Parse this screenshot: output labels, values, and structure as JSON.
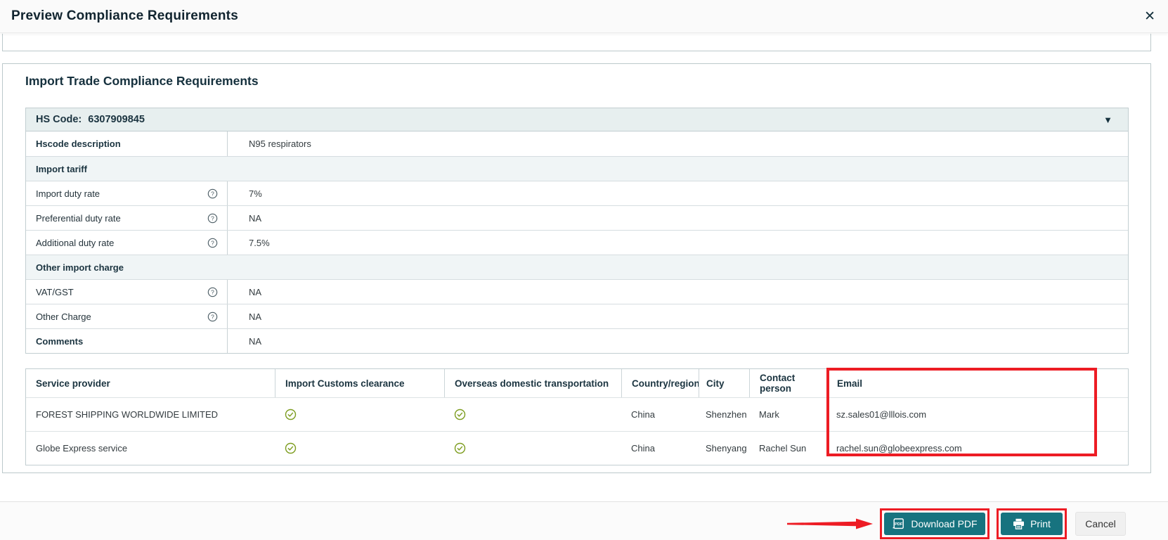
{
  "modal": {
    "title": "Preview Compliance Requirements"
  },
  "icons": {
    "close": "✕",
    "collapse_caret": "▼",
    "help": "?"
  },
  "section": {
    "heading": "Import Trade Compliance Requirements",
    "hs_code_label": "HS Code:",
    "hs_code_value": "6307909845"
  },
  "detail_table": {
    "rows": [
      {
        "type": "field",
        "label": "Hscode description",
        "value": "N95 respirators"
      },
      {
        "type": "section",
        "label": "Import tariff"
      },
      {
        "type": "field",
        "label": "Import duty rate",
        "value": "7%"
      },
      {
        "type": "field",
        "label": "Preferential duty rate",
        "value": "NA"
      },
      {
        "type": "field",
        "label": "Additional duty rate",
        "value": "7.5%"
      },
      {
        "type": "section",
        "label": "Other import charge"
      },
      {
        "type": "field",
        "label": "VAT/GST",
        "value": "NA"
      },
      {
        "type": "field",
        "label": "Other Charge",
        "value": "NA"
      },
      {
        "type": "field",
        "label": "Comments",
        "value": "NA"
      }
    ]
  },
  "providers_table": {
    "columns": [
      "Service provider",
      "Import Customs clearance",
      "Overseas domestic transportation",
      "Country/region",
      "City",
      "Contact person",
      "Email"
    ],
    "rows": [
      {
        "service_provider": "FOREST SHIPPING WORLDWIDE LIMITED",
        "import_customs_clearance": "yes",
        "overseas_domestic_transportation": "yes",
        "country": "China",
        "city": "Shenzhen",
        "contact": "Mark",
        "email": "sz.sales01@lllois.com"
      },
      {
        "service_provider": "Globe Express service",
        "import_customs_clearance": "yes",
        "overseas_domestic_transportation": "yes",
        "country": "China",
        "city": "Shenyang",
        "contact": "Rachel Sun",
        "email": "rachel.sun@globeexpress.com"
      }
    ]
  },
  "footer": {
    "download_pdf_label": "Download PDF",
    "print_label": "Print",
    "cancel_label": "Cancel"
  },
  "colors": {
    "teal": "#17737f",
    "annotation_red": "#ed1c24",
    "check_green": "#7d9d20",
    "dark_navy": "#15303d"
  }
}
